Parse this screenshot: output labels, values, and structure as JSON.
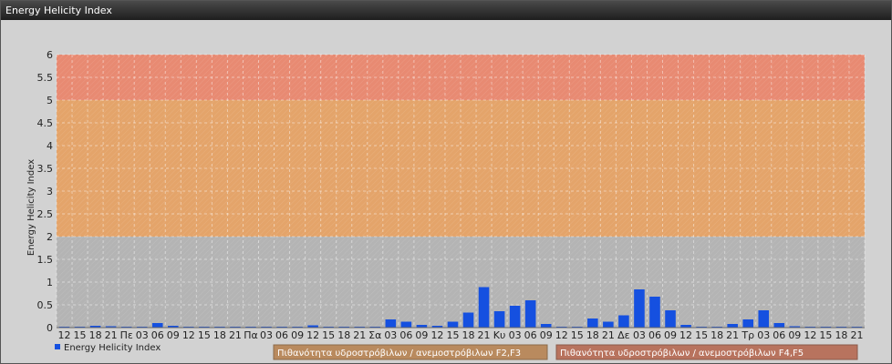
{
  "window": {
    "title": "Energy Helicity Index"
  },
  "colors": {
    "bar": "#1550e0",
    "band_low": "#b4b4b4",
    "band_mid": "#e4a46a",
    "band_high": "#e88a72",
    "legend_mid": "#b98a5e",
    "legend_high": "#b8735e"
  },
  "chart_data": {
    "type": "bar",
    "ylabel": "Energy Helicity Index",
    "ylim": [
      0,
      6
    ],
    "yticks": [
      "0",
      "0.5",
      "1",
      "1.5",
      "2",
      "2.5",
      "3",
      "3.5",
      "4",
      "4.5",
      "5",
      "5.5",
      "6"
    ],
    "grid": true,
    "bands": [
      {
        "from": 0,
        "to": 2,
        "color_key": "band_low"
      },
      {
        "from": 2,
        "to": 5,
        "color_key": "band_mid"
      },
      {
        "from": 5,
        "to": 6,
        "color_key": "band_high"
      }
    ],
    "categories": [
      "12",
      "15",
      "18",
      "21",
      "Πε",
      "03",
      "06",
      "09",
      "12",
      "15",
      "18",
      "21",
      "Πα",
      "03",
      "06",
      "09",
      "12",
      "15",
      "18",
      "21",
      "Σα",
      "03",
      "06",
      "09",
      "12",
      "15",
      "18",
      "21",
      "Κυ",
      "03",
      "06",
      "09",
      "12",
      "15",
      "18",
      "21",
      "Δε",
      "03",
      "06",
      "09",
      "12",
      "15",
      "18",
      "21",
      "Τρ",
      "03",
      "06",
      "09",
      "12",
      "15",
      "18",
      "21"
    ],
    "series": [
      {
        "name": "Energy Helicity Index",
        "values": [
          0.02,
          0.02,
          0.04,
          0.03,
          0.02,
          0.02,
          0.1,
          0.04,
          0.02,
          0.02,
          0.02,
          0.02,
          0.02,
          0.02,
          0.02,
          0.02,
          0.05,
          0.02,
          0.02,
          0.02,
          0.02,
          0.18,
          0.13,
          0.06,
          0.04,
          0.13,
          0.33,
          0.89,
          0.36,
          0.48,
          0.6,
          0.08,
          0.02,
          0.02,
          0.2,
          0.13,
          0.27,
          0.84,
          0.68,
          0.38,
          0.06,
          0.02,
          0.02,
          0.08,
          0.18,
          0.38,
          0.1,
          0.03,
          0.02,
          0.02,
          0.02,
          0.02
        ]
      }
    ],
    "legend": [
      {
        "label": "Energy Helicity Index"
      },
      {
        "label": "Πιθανότητα υδροστρόβιλων / ανεμοστρόβιλων F2,F3"
      },
      {
        "label": "Πιθανότητα υδροστρόβιλων / ανεμοστρόβιλων F4,F5"
      }
    ]
  }
}
